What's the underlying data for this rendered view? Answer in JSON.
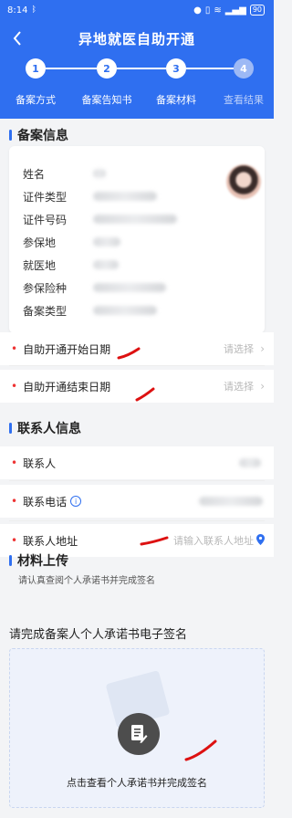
{
  "status_bar": {
    "time": "8:14",
    "battery": "90"
  },
  "header": {
    "title": "异地就医自助开通"
  },
  "steps": [
    {
      "num": "1",
      "label": "备案方式"
    },
    {
      "num": "2",
      "label": "备案告知书"
    },
    {
      "num": "3",
      "label": "备案材料"
    },
    {
      "num": "4",
      "label": "查看结果"
    }
  ],
  "filing_info": {
    "title": "备案信息",
    "rows": [
      {
        "label": "姓名"
      },
      {
        "label": "证件类型"
      },
      {
        "label": "证件号码"
      },
      {
        "label": "参保地"
      },
      {
        "label": "就医地"
      },
      {
        "label": "参保险种"
      },
      {
        "label": "备案类型"
      }
    ]
  },
  "date_fields": {
    "start_label": "自助开通开始日期",
    "end_label": "自助开通结束日期",
    "placeholder": "请选择"
  },
  "contact": {
    "title": "联系人信息",
    "person_label": "联系人",
    "phone_label": "联系电话",
    "address_label": "联系人地址",
    "address_placeholder": "请输入联系人地址"
  },
  "materials": {
    "title": "材料上传",
    "hint": "请认真查阅个人承诺书并完成签名",
    "sign_title": "请完成备案人个人承诺书电子签名",
    "sign_action": "点击查看个人承诺书并完成签名"
  },
  "colors": {
    "primary": "#2f6ff0",
    "required": "#e33333"
  }
}
